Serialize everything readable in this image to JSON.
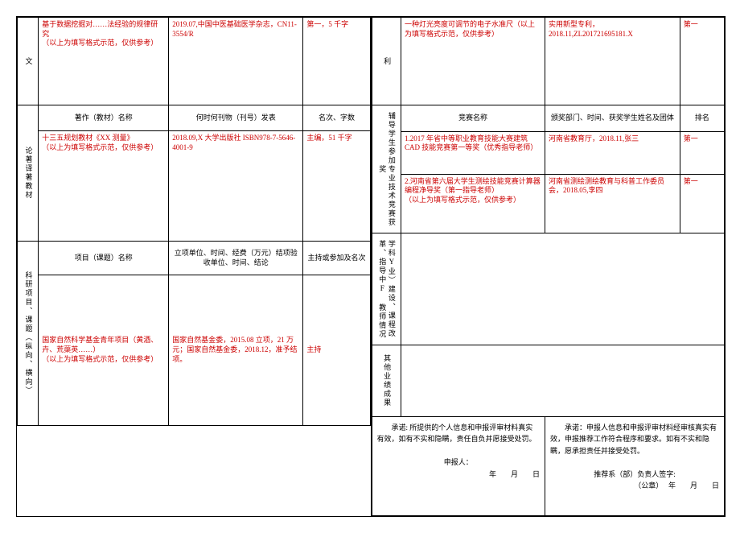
{
  "left": {
    "row1": {
      "sideLabel": "文",
      "c1": "基于数据挖掘对……法经验的规律研究\n（以上为填写格式示范，仅供参考）",
      "c2": "2019.07,中国中医基础医学杂志，CN11-3554/R",
      "c3": "第一，5 千字"
    },
    "headerA": {
      "h1": "著作（教材）名称",
      "h2": "何时何刊物（刊号）发表",
      "h3": "名次、字数"
    },
    "row2": {
      "sideLabel": "论著译著教材",
      "c1": "十三五规划教材《XX 测量》\n（以上为填写格式示范，仅供参考）",
      "c2": "2018.09,X 大学出版社 ISBN978-7-5646-4001-9",
      "c3": "主编，51 千字"
    },
    "headerB": {
      "h1": "项目（课题）名称",
      "h2": "立项单位、时间、经费（万元）结项验收单位、时间、结论",
      "h3": "主持或参加及名次"
    },
    "row3": {
      "sideLabel": "科研项目、课题（纵向、横向）",
      "c1": "国家自然科学基金青年项目（黄酒、卉、荒蕖英……）\n（以上为填写格式示范，仅供参考）",
      "c2": "国家自然基金委，2015.08 立项，21 万元；国家自然基金委，2018.12，准予结项。",
      "c3": "主持"
    }
  },
  "right": {
    "row1": {
      "sideLabel": "利",
      "c1": "一种灯光亮度可调节的电子水准尺（以上为填写格式示范，仅供参考）",
      "c2": "实用新型专利，2018.11,ZL201721695181.X",
      "c3": "第一"
    },
    "headerA": {
      "h1": "竞赛名称",
      "h2": "颁奖部门、时间、获奖学生姓名及团体",
      "h3": "排名"
    },
    "row2": {
      "sideLabel": "辅导学生参加专业技术竞赛获奖",
      "item1": "1.2017 年省中等职业教育技能大赛建筑 CAD 技能竞赛第一等奖（优秀指导老师）",
      "item1b": "河南省教育厅，2018.11,张三",
      "item1c": "第一",
      "item2": "2.河南省第六届大学生测绘技能竞赛计算器编程净导奖（第一指导老师）\n（以上为填写格式示范，仅供参考）",
      "item2b": "河南省测绘测绘教育与科普工作委员会，2018.05,李四",
      "item2c": "第一"
    },
    "row3": {
      "sideLabel": "学科Y业）建设、课程改革、指导中F 教师情况"
    },
    "row4": {
      "sideLabel": "其他业绩成果"
    },
    "footerLeft": {
      "line1": "承诺: 所提供的个人信息和申报评审材料真实有效，如有不实和隐瞒，责任自负并愿接受处罚。",
      "sign": "申报人：",
      "date": "年　　月　　日"
    },
    "footerRight": {
      "line1": "承诺：申报人信息和申报评审材料经审核真实有效，申报推荐工作符合程序和要求。如有不实和隐瞒，愿承担责任并接受处罚。",
      "sign": "推荐系（部）负责人签字:",
      "seal": "（公章）",
      "date": "年　　月　　日"
    }
  }
}
